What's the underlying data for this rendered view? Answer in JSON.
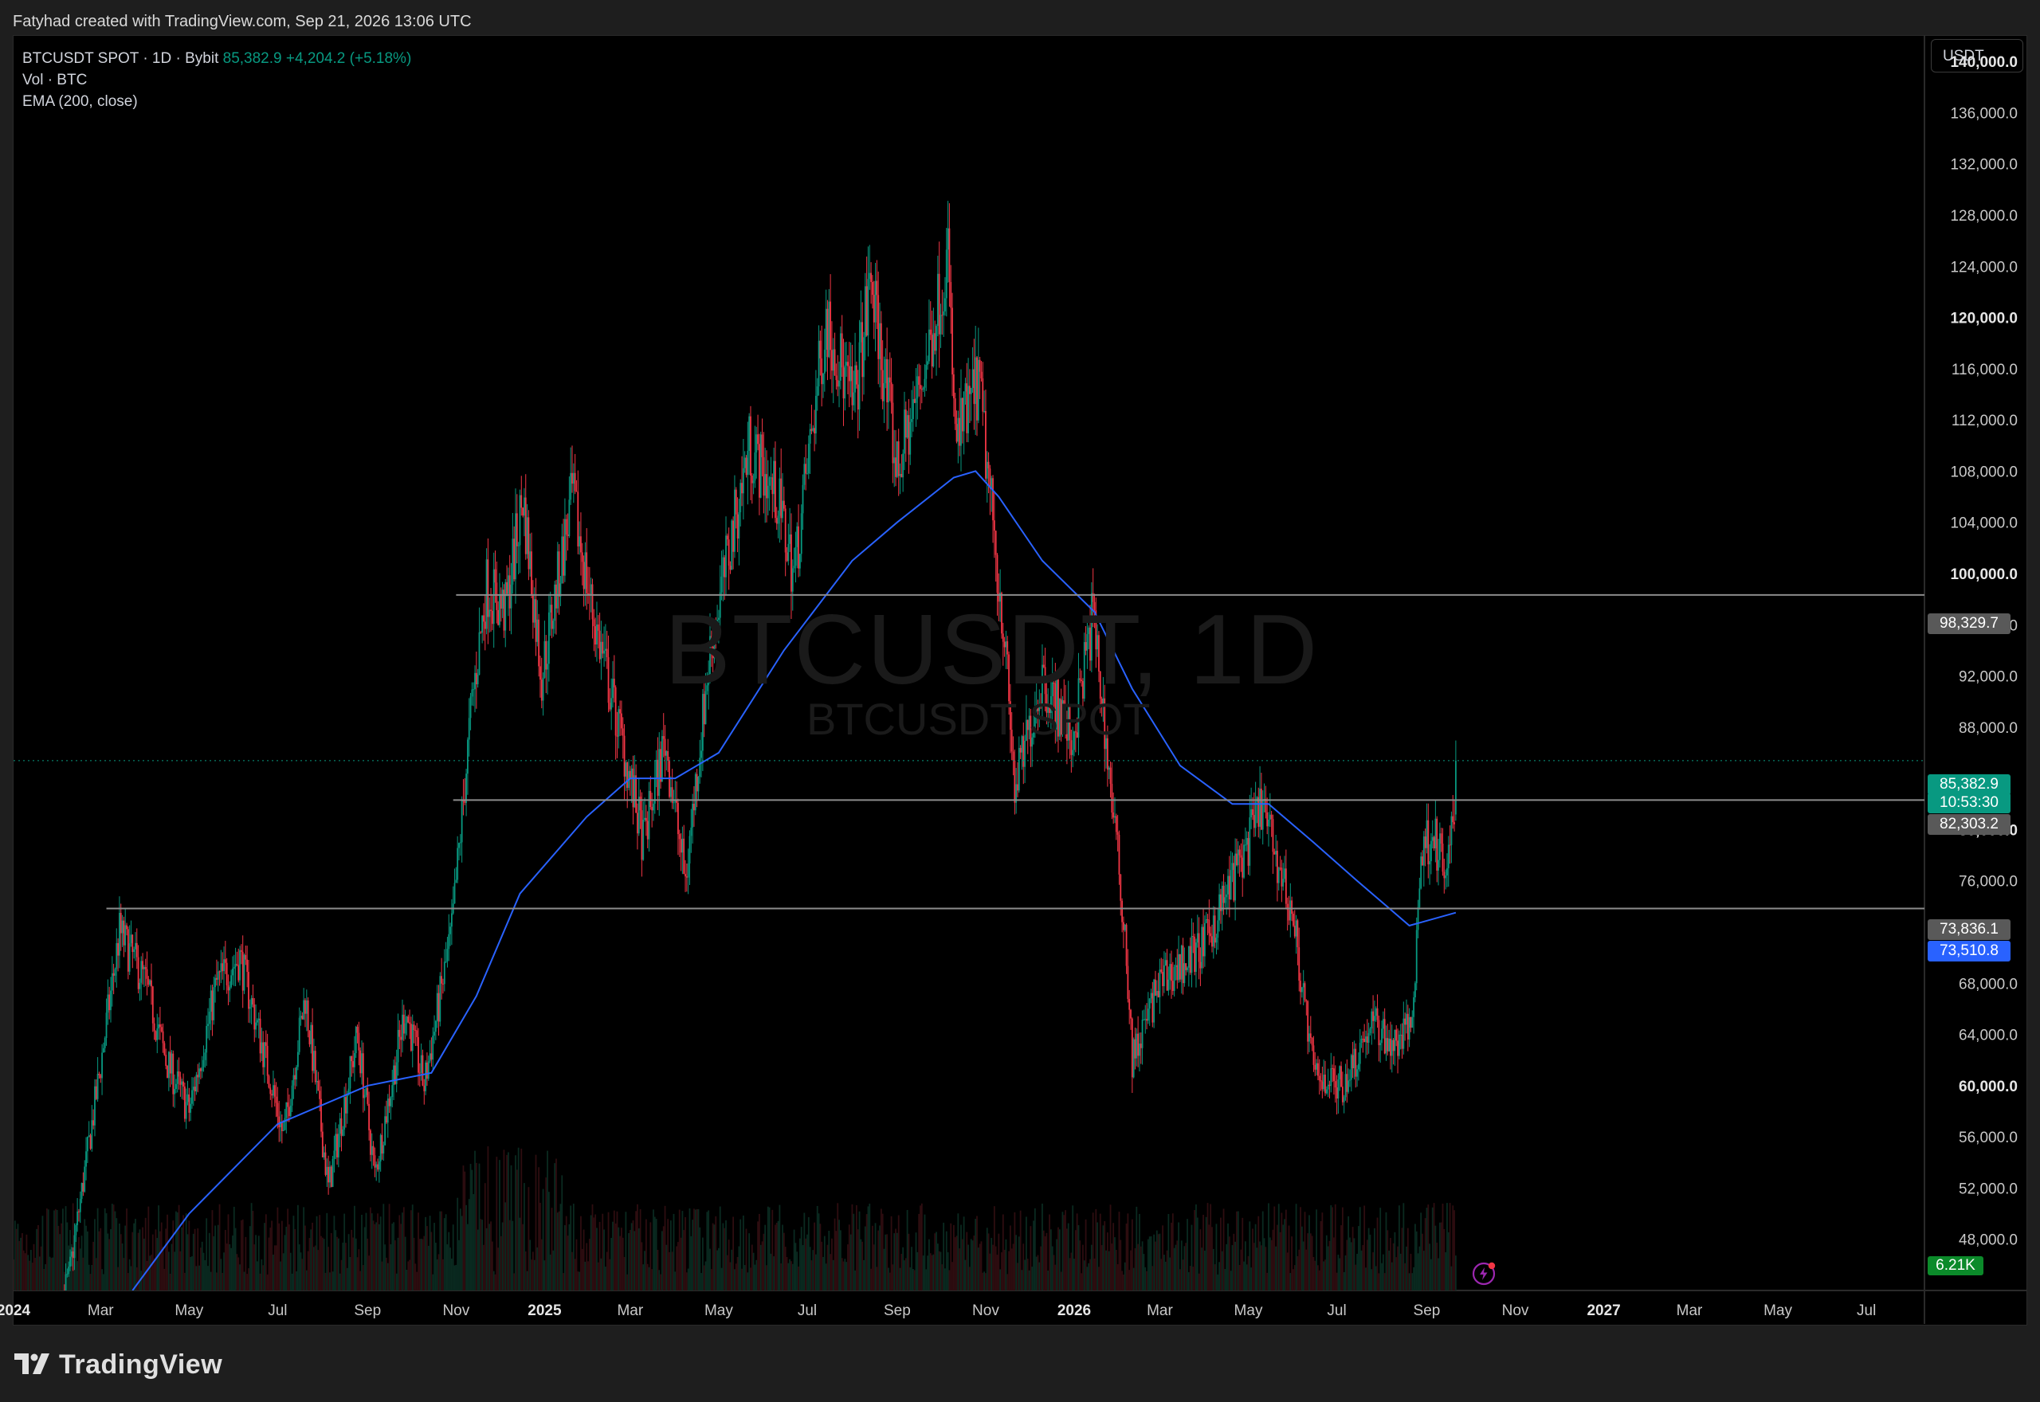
{
  "header": {
    "credit": "Fatyhad created with TradingView.com, Sep 21, 2026 13:06 UTC"
  },
  "legend": {
    "symbol": "BTCUSDT SPOT · 1D · Bybit",
    "price": "85,382.9",
    "change": "+4,204.2 (+5.18%)",
    "vol_label": "Vol · BTC",
    "ema_label": "EMA (200, close)"
  },
  "watermark": {
    "line1": "BTCUSDT, 1D",
    "line2": "BTCUSDT SPOT"
  },
  "unit": "USDT",
  "price_tags": {
    "resistance_high": "98,329.7",
    "last_price": "85,382.9",
    "countdown": "10:53:30",
    "resistance_mid": "82,303.2",
    "support_low": "73,836.1",
    "ema_value": "73,510.8"
  },
  "volume_tag": "6.21K",
  "logo_text": "TradingView",
  "colors": {
    "up": "#089981",
    "down": "#f23645",
    "ema": "#2962ff",
    "hline": "#8c8c8c",
    "background": "#000000"
  },
  "chart_data": {
    "type": "candlestick",
    "symbol": "BTCUSDT",
    "interval": "1D",
    "y_axis": {
      "ticks": [
        48000,
        52000,
        56000,
        60000,
        64000,
        68000,
        76000,
        80000,
        88000,
        92000,
        96000,
        100000,
        104000,
        108000,
        112000,
        116000,
        120000,
        124000,
        128000,
        132000,
        136000,
        140000
      ],
      "tick_labels": [
        "48,000.0",
        "52,000.0",
        "56,000.0",
        "60,000.0",
        "64,000.0",
        "68,000.0",
        "76,000.0",
        "80,000.0",
        "88,000.0",
        "92,000.0",
        "96,000.0",
        "100,000.0",
        "104,000.0",
        "108,000.0",
        "112,000.0",
        "116,000.0",
        "120,000.0",
        "124,000.0",
        "128,000.0",
        "132,000.0",
        "136,000.0",
        "140,000.0"
      ],
      "bold_ticks": [
        60000,
        80000,
        100000,
        120000,
        140000
      ],
      "range": [
        44000,
        142000
      ]
    },
    "x_axis": {
      "range": [
        "2024-01-01",
        "2027-08-10"
      ],
      "ticks": [
        {
          "date": "2024-01-01",
          "label": "2024",
          "bold": true
        },
        {
          "date": "2024-03-01",
          "label": "Mar"
        },
        {
          "date": "2024-05-01",
          "label": "May"
        },
        {
          "date": "2024-07-01",
          "label": "Jul"
        },
        {
          "date": "2024-09-01",
          "label": "Sep"
        },
        {
          "date": "2024-11-01",
          "label": "Nov"
        },
        {
          "date": "2025-01-01",
          "label": "2025",
          "bold": true
        },
        {
          "date": "2025-03-01",
          "label": "Mar"
        },
        {
          "date": "2025-05-01",
          "label": "May"
        },
        {
          "date": "2025-07-01",
          "label": "Jul"
        },
        {
          "date": "2025-09-01",
          "label": "Sep"
        },
        {
          "date": "2025-11-01",
          "label": "Nov"
        },
        {
          "date": "2026-01-01",
          "label": "2026",
          "bold": true
        },
        {
          "date": "2026-03-01",
          "label": "Mar"
        },
        {
          "date": "2026-05-01",
          "label": "May"
        },
        {
          "date": "2026-07-01",
          "label": "Jul"
        },
        {
          "date": "2026-09-01",
          "label": "Sep"
        },
        {
          "date": "2026-11-01",
          "label": "Nov"
        },
        {
          "date": "2027-01-01",
          "label": "2027",
          "bold": true
        },
        {
          "date": "2027-03-01",
          "label": "Mar"
        },
        {
          "date": "2027-05-01",
          "label": "May"
        },
        {
          "date": "2027-07-01",
          "label": "Jul"
        }
      ]
    },
    "price_path": [
      [
        "2024-01-01",
        42000
      ],
      [
        "2024-01-22",
        40000
      ],
      [
        "2024-02-08",
        45000
      ],
      [
        "2024-02-28",
        60000
      ],
      [
        "2024-03-14",
        72000
      ],
      [
        "2024-04-01",
        68000
      ],
      [
        "2024-04-15",
        62000
      ],
      [
        "2024-05-01",
        58000
      ],
      [
        "2024-05-20",
        68000
      ],
      [
        "2024-06-05",
        70000
      ],
      [
        "2024-06-25",
        61000
      ],
      [
        "2024-07-05",
        56000
      ],
      [
        "2024-07-20",
        67000
      ],
      [
        "2024-08-05",
        52000
      ],
      [
        "2024-08-25",
        64000
      ],
      [
        "2024-09-06",
        53000
      ],
      [
        "2024-09-27",
        66000
      ],
      [
        "2024-10-10",
        60000
      ],
      [
        "2024-10-29",
        72000
      ],
      [
        "2024-11-12",
        90000
      ],
      [
        "2024-11-22",
        99000
      ],
      [
        "2024-12-05",
        97000
      ],
      [
        "2024-12-17",
        106000
      ],
      [
        "2024-12-30",
        92000
      ],
      [
        "2025-01-20",
        106000
      ],
      [
        "2025-02-03",
        97000
      ],
      [
        "2025-02-25",
        86000
      ],
      [
        "2025-03-10",
        79000
      ],
      [
        "2025-03-25",
        87000
      ],
      [
        "2025-04-08",
        76000
      ],
      [
        "2025-04-25",
        94000
      ],
      [
        "2025-05-22",
        110000
      ],
      [
        "2025-06-10",
        106000
      ],
      [
        "2025-06-22",
        100000
      ],
      [
        "2025-07-14",
        120000
      ],
      [
        "2025-08-02",
        113000
      ],
      [
        "2025-08-14",
        123000
      ],
      [
        "2025-09-01",
        108000
      ],
      [
        "2025-09-20",
        116000
      ],
      [
        "2025-10-06",
        125000
      ],
      [
        "2025-10-11",
        110000
      ],
      [
        "2025-10-27",
        115000
      ],
      [
        "2025-11-14",
        95000
      ],
      [
        "2025-11-21",
        83000
      ],
      [
        "2025-12-10",
        92000
      ],
      [
        "2025-12-31",
        87000
      ],
      [
        "2026-01-14",
        97000
      ],
      [
        "2026-02-05",
        72000
      ],
      [
        "2026-02-10",
        62000
      ],
      [
        "2026-03-01",
        68000
      ],
      [
        "2026-04-01",
        71000
      ],
      [
        "2026-05-01",
        79000
      ],
      [
        "2026-05-10",
        82000
      ],
      [
        "2026-06-01",
        73000
      ],
      [
        "2026-06-15",
        61000
      ],
      [
        "2026-07-05",
        60000
      ],
      [
        "2026-07-25",
        65000
      ],
      [
        "2026-08-10",
        63000
      ],
      [
        "2026-08-22",
        65000
      ],
      [
        "2026-08-28",
        78000
      ],
      [
        "2026-09-05",
        80000
      ],
      [
        "2026-09-14",
        76000
      ],
      [
        "2026-09-20",
        81178
      ],
      [
        "2026-09-21",
        85382.9
      ]
    ],
    "ema_200": [
      [
        "2024-03-23",
        44000
      ],
      [
        "2024-05-01",
        50000
      ],
      [
        "2024-07-01",
        57000
      ],
      [
        "2024-09-01",
        60000
      ],
      [
        "2024-10-15",
        61000
      ],
      [
        "2024-11-15",
        67000
      ],
      [
        "2024-12-15",
        75000
      ],
      [
        "2025-01-30",
        81000
      ],
      [
        "2025-03-01",
        84000
      ],
      [
        "2025-04-01",
        84000
      ],
      [
        "2025-05-01",
        86000
      ],
      [
        "2025-06-15",
        94000
      ],
      [
        "2025-08-01",
        101000
      ],
      [
        "2025-09-01",
        104000
      ],
      [
        "2025-10-10",
        107500
      ],
      [
        "2025-10-25",
        108000
      ],
      [
        "2025-11-10",
        106000
      ],
      [
        "2025-12-10",
        101000
      ],
      [
        "2026-01-15",
        97000
      ],
      [
        "2026-02-10",
        91000
      ],
      [
        "2026-03-15",
        85000
      ],
      [
        "2026-04-20",
        82000
      ],
      [
        "2026-05-15",
        82000
      ],
      [
        "2026-06-15",
        79000
      ],
      [
        "2026-07-15",
        76000
      ],
      [
        "2026-08-20",
        72500
      ],
      [
        "2026-09-21",
        73510.8
      ]
    ],
    "horizontal_lines": [
      {
        "value": 98329.7,
        "from": "2024-11-01"
      },
      {
        "value": 82303.2,
        "from": "2024-10-30"
      },
      {
        "value": 73836.1,
        "from": "2024-03-05"
      }
    ],
    "last_price": 85382.9
  }
}
